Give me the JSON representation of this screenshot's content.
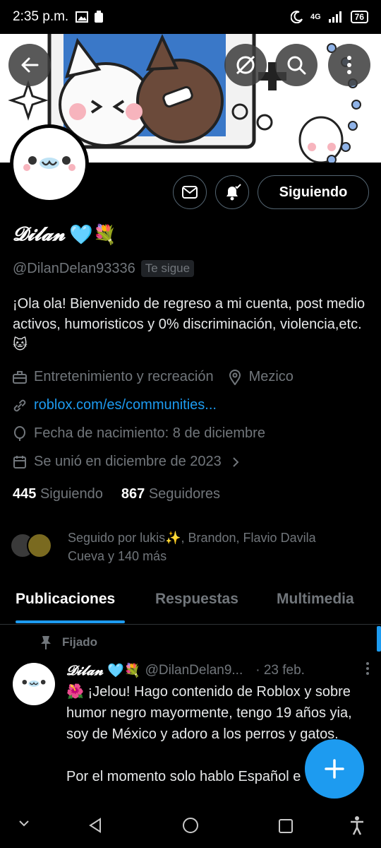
{
  "status_bar": {
    "time": "2:35 p.m.",
    "network": "4G",
    "battery": "76"
  },
  "header": {
    "back_icon": "arrow-left-icon",
    "grok_icon": "slash-circle-icon",
    "search_icon": "search-icon",
    "more_icon": "more-vertical-icon"
  },
  "profile": {
    "name": "𝓓𝓲𝓵𝓪𝓷",
    "name_emoji": "🩵💐",
    "handle": "@DilanDelan93336",
    "follows_you": "Te sigue",
    "follow_button": "Siguiendo",
    "bio": "¡Ola ola! Bienvenido de regreso a mi cuenta, post medio activos, humoristicos y 0% discriminación, violencia,etc. 🐱",
    "category": "Entretenimiento y recreación",
    "location": "Mezico",
    "website": "roblox.com/es/communities...",
    "birthday": "Fecha de nacimiento: 8 de diciembre",
    "joined": "Se unió en diciembre de 2023",
    "following_count": "445",
    "following_label": "Siguiendo",
    "followers_count": "867",
    "followers_label": "Seguidores",
    "followed_by": "Seguido por lukis✨, Brandon, Flavio Davila Cueva y 140 más"
  },
  "tabs": [
    {
      "label": "Publicaciones",
      "active": true
    },
    {
      "label": "Respuestas",
      "active": false
    },
    {
      "label": "Multimedia",
      "active": false
    }
  ],
  "post": {
    "pinned_label": "Fijado",
    "author_name": "𝓓𝓲𝓵𝓪𝓷",
    "author_emoji": "🩵💐",
    "author_handle": "@DilanDelan9...",
    "date": "· 23 feb.",
    "text": "🌺 ¡Jelou! Hago contenido de Roblox y sobre humor negro mayormente, tengo 19 años yia, soy de México y adoro a los perros y gatos.",
    "text2": "Por el momento solo hablo Español e"
  },
  "colors": {
    "accent": "#1d9bf0",
    "muted": "#71767b",
    "background": "#000000"
  }
}
